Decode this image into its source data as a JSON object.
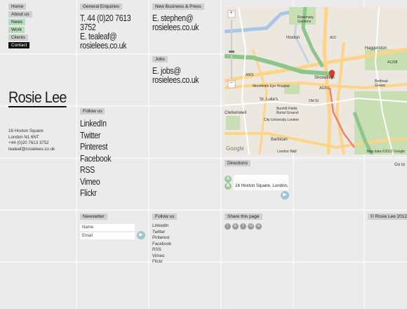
{
  "nav": [
    "Home",
    "About us",
    "News",
    "Work",
    "Clients",
    "Contact"
  ],
  "brand": "Rosie Lee",
  "address": [
    "16 Hoxton Square",
    "London N1 6NT",
    "+44 (0)20 7613 3752",
    "tealeaf@rosielees.co.uk"
  ],
  "general": {
    "label": "General Enquiries",
    "tel": "T. 44 (0)20 7613",
    "tel2": "3752",
    "email": "E. tealeaf@",
    "email2": "rosielees.co.uk"
  },
  "business": {
    "label": "New Business & Press",
    "email": "E. stephen@",
    "email2": "rosielees.co.uk"
  },
  "jobs": {
    "label": "Jobs",
    "email": "E. jobs@",
    "email2": "rosielees.co.uk"
  },
  "follow_big": {
    "label": "Follow us",
    "links": [
      "LinkedIn",
      "Twitter",
      "Pinterest",
      "Facebook",
      "RSS",
      "Vimeo",
      "Flickr"
    ]
  },
  "map": {
    "attribution": "Map data ©2012 Google",
    "google": "Google",
    "places": [
      "Rosemary Gardens",
      "Hoxton",
      "Haggerston",
      "Shoreditch",
      "Bethnal Green",
      "St. Luke's",
      "Moorfields Eye Hospital",
      "City University London",
      "Bunhill Fields Burial Ground",
      "Barbican",
      "Clerkenwell",
      "London Wall"
    ],
    "roads": [
      "A501",
      "A10",
      "A1208",
      "A5201",
      "Old St"
    ]
  },
  "directions": {
    "label": "Directions",
    "go_to": "Go to",
    "from_marker": "A",
    "to_marker": "B",
    "to_value": "16 Hoxton Square, London, N"
  },
  "newsletter": {
    "label": "Newsletter",
    "name_placeholder": "Name",
    "email_placeholder": "Email"
  },
  "follow_small": {
    "label": "Follow us",
    "links": [
      "LinkedIn",
      "Twitter",
      "Pinterest",
      "Facebook",
      "RSS",
      "Vimeo",
      "Flickr"
    ]
  },
  "share": {
    "label": "Share this page",
    "icons": [
      "t",
      "in",
      "f",
      "+1",
      "✉"
    ]
  },
  "copyright": "© Rosie Lee 2012"
}
